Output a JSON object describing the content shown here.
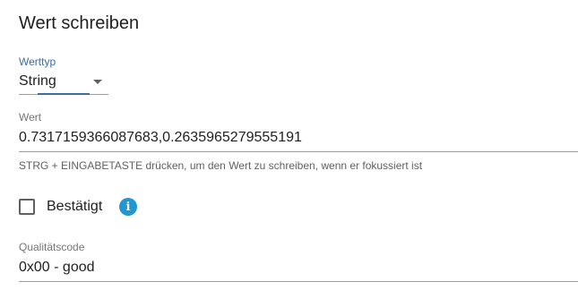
{
  "dialog": {
    "title": "Wert schreiben"
  },
  "value_type": {
    "label": "Werttyp",
    "selected": "String",
    "accent_color": "#3a6ea5"
  },
  "value": {
    "label": "Wert",
    "current_value": "0.7317159366087683,0.2635965279555191",
    "helper_text": "STRG + EINGABETASTE drücken, um den Wert zu schreiben, wenn er fokussiert ist"
  },
  "acknowledged": {
    "label": "Bestätigt",
    "checked": false,
    "info_icon": "info-icon",
    "info_color": "#2196d3"
  },
  "quality_code": {
    "label": "Qualitätscode",
    "current_value": "0x00 - good"
  }
}
